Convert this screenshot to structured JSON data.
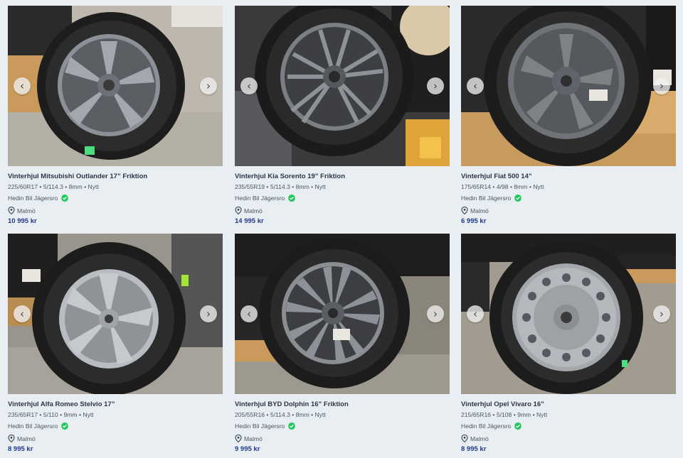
{
  "listings": [
    {
      "title": "Vinterhjul Mitsubishi Outlander 17” Friktion",
      "specs": "225/60R17 • 5/114.3 • 8mm • Nytt",
      "seller": "Hedin Bil Jägersro",
      "location": "Malmö",
      "price": "10 995 kr"
    },
    {
      "title": "Vinterhjul Kia Sorento 19” Friktion",
      "specs": "235/55R19 • 5/114.3 • 8mm • Nytt",
      "seller": "Hedin Bil Jägersro",
      "location": "Malmö",
      "price": "14 995 kr"
    },
    {
      "title": "Vinterhjul Fiat 500 14”",
      "specs": "175/65R14 • 4/98 • 8mm • Nytt",
      "seller": "Hedin Bil Jägersro",
      "location": "Malmö",
      "price": "6 995 kr"
    },
    {
      "title": "Vinterhjul Alfa Romeo Stelvio 17”",
      "specs": "235/65R17 • 5/110 • 9mm • Nytt",
      "seller": "Hedin Bil Jägersro",
      "location": "Malmö",
      "price": "8 995 kr"
    },
    {
      "title": "Vinterhjul BYD Dolphin 16” Friktion",
      "specs": "205/55R16 • 5/114.3 • 8mm • Nytt",
      "seller": "Hedin Bil Jägersro",
      "location": "Malmö",
      "price": "9 995 kr"
    },
    {
      "title": "Vinterhjul Opel Vivaro 16”",
      "specs": "215/65R16 • 5/108 • 9mm • Nytt",
      "seller": "Hedin Bil Jägersro",
      "location": "Malmö",
      "price": "8 995 kr"
    }
  ],
  "icons": {
    "prev": "chevron-left-icon",
    "next": "chevron-right-icon",
    "verified": "verified-check-icon",
    "location": "location-pin-icon"
  },
  "colors": {
    "background": "#e9eef3",
    "price": "#1f3a8a",
    "verified": "#22c55e"
  }
}
